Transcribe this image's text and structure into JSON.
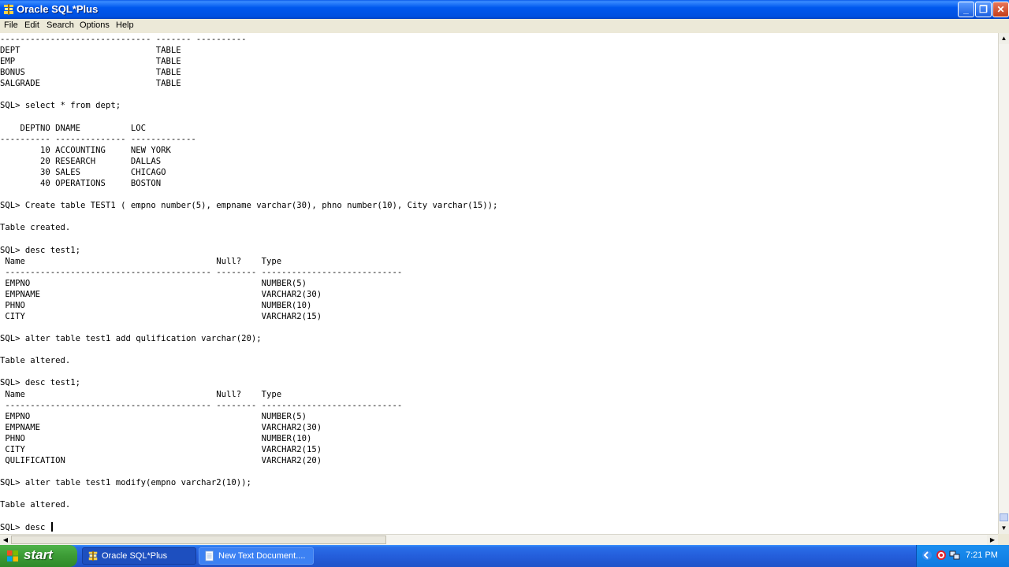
{
  "window": {
    "title": "Oracle SQL*Plus"
  },
  "menu": [
    "File",
    "Edit",
    "Search",
    "Options",
    "Help"
  ],
  "console": {
    "lines": [
      "------------------------------ ------- ----------",
      "DEPT                           TABLE",
      "EMP                            TABLE",
      "BONUS                          TABLE",
      "SALGRADE                       TABLE",
      "",
      "SQL> select * from dept;",
      "",
      "    DEPTNO DNAME          LOC",
      "---------- -------------- -------------",
      "        10 ACCOUNTING     NEW YORK",
      "        20 RESEARCH       DALLAS",
      "        30 SALES          CHICAGO",
      "        40 OPERATIONS     BOSTON",
      "",
      "SQL> Create table TEST1 ( empno number(5), empname varchar(30), phno number(10), City varchar(15));",
      "",
      "Table created.",
      "",
      "SQL> desc test1;",
      " Name                                      Null?    Type",
      " ----------------------------------------- -------- ----------------------------",
      " EMPNO                                              NUMBER(5)",
      " EMPNAME                                            VARCHAR2(30)",
      " PHNO                                               NUMBER(10)",
      " CITY                                               VARCHAR2(15)",
      "",
      "SQL> alter table test1 add qulification varchar(20);",
      "",
      "Table altered.",
      "",
      "SQL> desc test1;",
      " Name                                      Null?    Type",
      " ----------------------------------------- -------- ----------------------------",
      " EMPNO                                              NUMBER(5)",
      " EMPNAME                                            VARCHAR2(30)",
      " PHNO                                               NUMBER(10)",
      " CITY                                               VARCHAR2(15)",
      " QULIFICATION                                       VARCHAR2(20)",
      "",
      "SQL> alter table test1 modify(empno varchar2(10));",
      "",
      "Table altered.",
      "",
      "SQL> desc "
    ]
  },
  "taskbar": {
    "start_label": "start",
    "tasks": [
      "Oracle SQL*Plus",
      "New Text Document...."
    ],
    "clock": "7:21 PM"
  },
  "icons": {
    "app": "sqlplus-icon",
    "start": "windows-flag-icon",
    "notepad": "notepad-icon",
    "tray": [
      "tray-arrow-icon",
      "antivirus-icon",
      "network-icon"
    ]
  },
  "colors": {
    "titlebar": "#0054e3",
    "taskbar": "#245edb",
    "start": "#3c9b35"
  }
}
